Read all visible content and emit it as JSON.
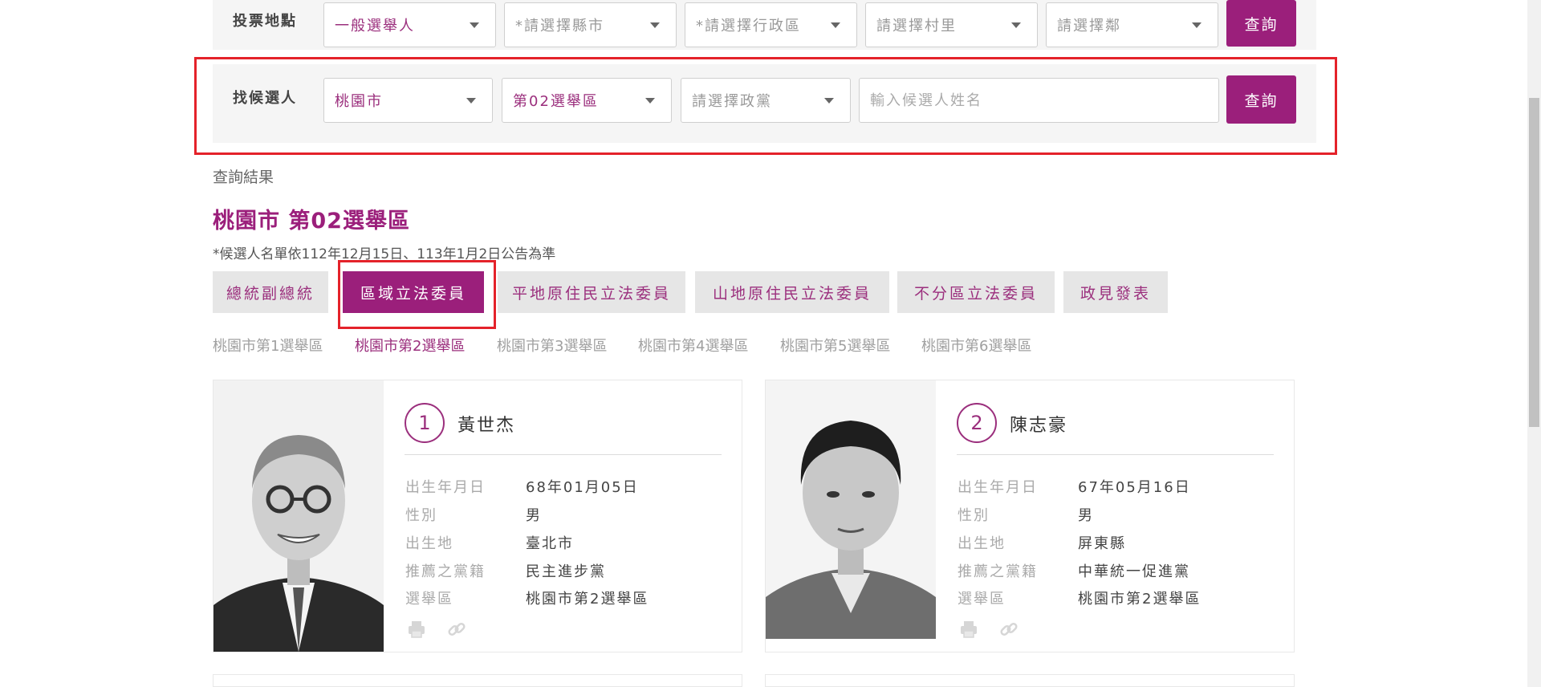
{
  "filters": {
    "polling": {
      "label": "投票地點",
      "selects": [
        "一般選舉人",
        "*請選擇縣市",
        "*請選擇行政區",
        "請選擇村里",
        "請選擇鄰"
      ],
      "button": "查詢"
    },
    "candidate": {
      "label": "找候選人",
      "selects": [
        "桃園市",
        "第02選舉區",
        "請選擇政黨"
      ],
      "name_placeholder": "輸入候選人姓名",
      "button": "查詢"
    }
  },
  "results": {
    "label": "查詢結果",
    "title": "桃園市 第02選舉區",
    "note": "*候選人名單依112年12月15日、113年1月2日公告為準"
  },
  "tabs": [
    "總統副總統",
    "區域立法委員",
    "平地原住民立法委員",
    "山地原住民立法委員",
    "不分區立法委員",
    "政見發表"
  ],
  "active_tab": 1,
  "district_tabs": [
    "桃園市第1選舉區",
    "桃園市第2選舉區",
    "桃園市第3選舉區",
    "桃園市第4選舉區",
    "桃園市第5選舉區",
    "桃園市第6選舉區"
  ],
  "active_district": 1,
  "field_labels": [
    "出生年月日",
    "性別",
    "出生地",
    "推薦之黨籍",
    "選舉區"
  ],
  "candidates": [
    {
      "number": "1",
      "name": "黃世杰",
      "values": [
        "68年01月05日",
        "男",
        "臺北市",
        "民主進步黨",
        "桃園市第2選舉區"
      ]
    },
    {
      "number": "2",
      "name": "陳志豪",
      "values": [
        "67年05月16日",
        "男",
        "屏東縣",
        "中華統一促進黨",
        "桃園市第2選舉區"
      ]
    }
  ],
  "icons": {
    "caret": "chevron-down-icon",
    "print": "print-icon",
    "link": "link-icon"
  },
  "colors": {
    "accent": "#9b1f7b",
    "highlight": "#e4222a"
  }
}
